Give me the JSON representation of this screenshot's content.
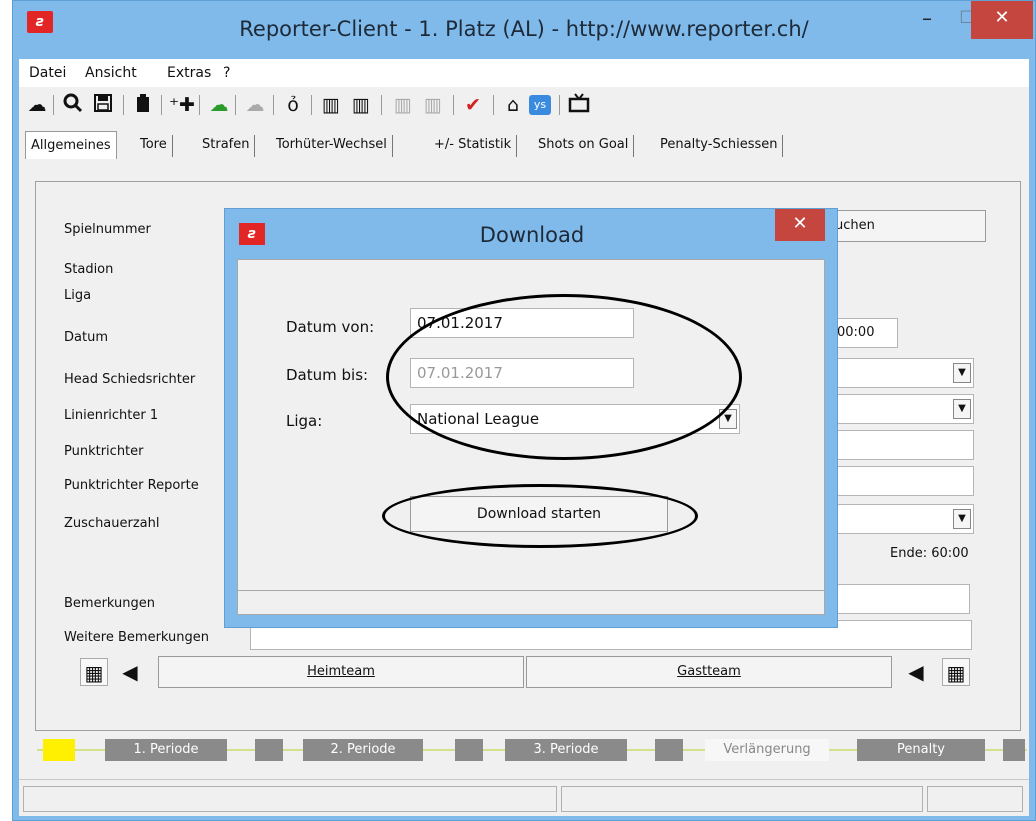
{
  "window": {
    "title": "Reporter-Client  -  1. Platz (AL)  -  http://www.reporter.ch/",
    "minimize": "–",
    "maximize": "☐",
    "close": "✕"
  },
  "menu": [
    "Datei",
    "Ansicht",
    "Extras",
    "?"
  ],
  "toolbar": {
    "icons": [
      "cloud-download-icon",
      "search-icon",
      "save-icon",
      "clipboard-icon",
      "add-person-icon",
      "cloud-upload-icon",
      "cloud-disabled-icon",
      "stopwatch-icon",
      "team-icon",
      "team-alt-icon",
      "team-disabled-icon",
      "team-alt-disabled-icon",
      "check-icon",
      "home-icon",
      "ys-icon",
      "tv-icon"
    ]
  },
  "tabs": [
    "Allgemeines",
    "Tore",
    "Strafen",
    "Torhüter-Wechsel",
    "+/- Statistik",
    "Shots on Goal",
    "Penalty-Schiessen"
  ],
  "form": {
    "labels": {
      "spielnummer": "Spielnummer",
      "stadion": "Stadion",
      "liga": "Liga",
      "datum": "Datum",
      "head": "Head Schiedsrichter",
      "linien": "Linienrichter 1",
      "punkt": "Punktrichter",
      "punkt_rep": "Punktrichter Reporte",
      "zuschauer": "Zuschauerzahl",
      "bemerkungen": "Bemerkungen",
      "weitere": "Weitere Bemerkungen"
    },
    "suchen_partial": "uchen",
    "time_partial": "00:00",
    "ende": "Ende: 60:00",
    "heimteam": "Heimteam",
    "gastteam": "Gastteam"
  },
  "periods": [
    "1. Periode",
    "2. Periode",
    "3. Periode",
    "Verlängerung",
    "Penalty"
  ],
  "dialog": {
    "title": "Download",
    "close": "✕",
    "datum_von_label": "Datum von:",
    "datum_von_value": "07.01.2017",
    "datum_bis_label": "Datum bis:",
    "datum_bis_value": "07.01.2017",
    "liga_label": "Liga:",
    "liga_value": "National League",
    "download_button": "Download starten"
  },
  "colors": {
    "title_bar": "#7fbaea",
    "close_red": "#c4463e",
    "period_active": "#ffef00",
    "period_box": "#8a8a8a"
  }
}
